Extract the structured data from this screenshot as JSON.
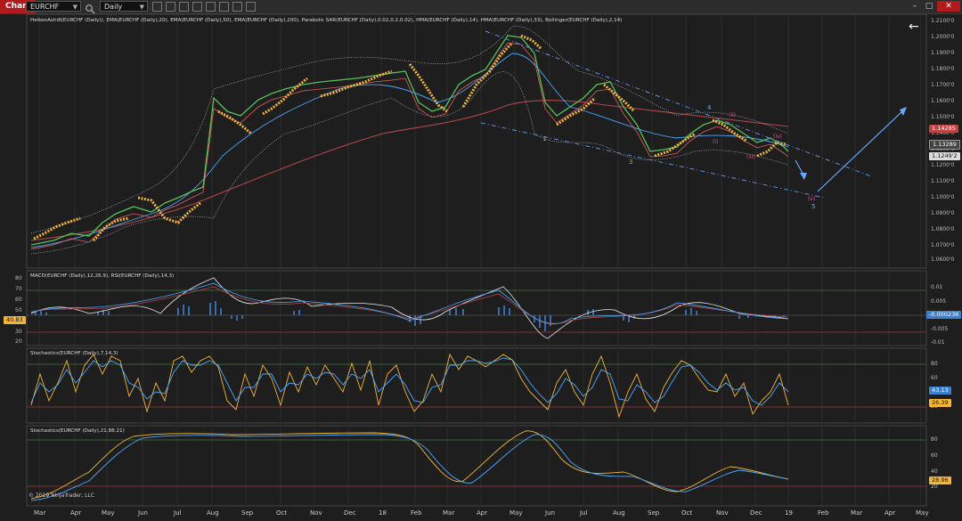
{
  "toolbar": {
    "chart_tab": "Chart",
    "instrument": "EURCHF",
    "period": "Daily",
    "search_icon": "magnifier-icon"
  },
  "panels": {
    "price_label": "HeikenAshi8(EURCHF (Daily)), EMA(EURCHF (Daily),20), EMA(EURCHF (Daily),50), EMA(EURCHF (Daily),200), Parabolic SAR(EURCHF (Daily),0.02,0.2,0.02), HMA(EURCHF (Daily),14), HMA(EURCHF (Daily),33), Bollinger(EURCHF (Daily),2,14)",
    "macd_label": "MACD(EURCHF (Daily),12,26,9), RSI(EURCHF (Daily),14,3)",
    "stoch1_label": "Stochastics(EURCHF (Daily),7,14,3)",
    "stoch2_label": "Stochastics(EURCHF (Daily),21,88,21)"
  },
  "price_axis": [
    "1.2100'0",
    "1.2000'0",
    "1.1900'0",
    "1.1800'0",
    "1.1700'0",
    "1.1600'0",
    "1.1500'0",
    "1.1400'0",
    "1.1300'0",
    "1.1200'0",
    "1.1100'0",
    "1.1000'0",
    "1.0900'0",
    "1.0800'0",
    "1.0700'0",
    "1.0600'0"
  ],
  "price_badges": {
    "upper": "1.14285",
    "mid": "1.13289",
    "last": "1.1249'2"
  },
  "macd_axis_right": [
    "0.01",
    "0.005",
    "0",
    "-0.005",
    "-0.01"
  ],
  "macd_badge": "-0.000236",
  "rsi_axis_left": [
    "80",
    "70",
    "60",
    "50",
    "40",
    "30",
    "20"
  ],
  "rsi_badge": "40.83",
  "stoch1_axis": [
    "80",
    "60",
    "40",
    "20"
  ],
  "stoch1_badges": {
    "d": "43.13",
    "k": "26.39"
  },
  "stoch2_axis": [
    "80",
    "60",
    "40",
    "20"
  ],
  "stoch2_badge": "28.96",
  "x_labels": [
    "Mar",
    "Apr",
    "May",
    "Jun",
    "Jul",
    "Aug",
    "Sep",
    "Oct",
    "Nov",
    "Dec",
    "18",
    "Feb",
    "Mar",
    "Apr",
    "May",
    "Jun",
    "Jul",
    "Aug",
    "Sep",
    "Oct",
    "Nov",
    "Dec",
    "19",
    "Feb",
    "Mar",
    "Apr",
    "May"
  ],
  "wave_labels": {
    "w1": "1",
    "w3": "3",
    "w4": "4",
    "w5": "5",
    "i": "(i)",
    "ii": "(ii)",
    "iii": "(iii)",
    "iv": "(iv)",
    "v": "(v)"
  },
  "copyright": "© 2019 NinjaTrader, LLC",
  "colors": {
    "bg": "#1e1e1e",
    "accent": "#b11a1a",
    "sar": "#f2b53a",
    "ema200": "#b04848",
    "hma": "#4aa8ff",
    "channel": "#5b8fe0"
  }
}
